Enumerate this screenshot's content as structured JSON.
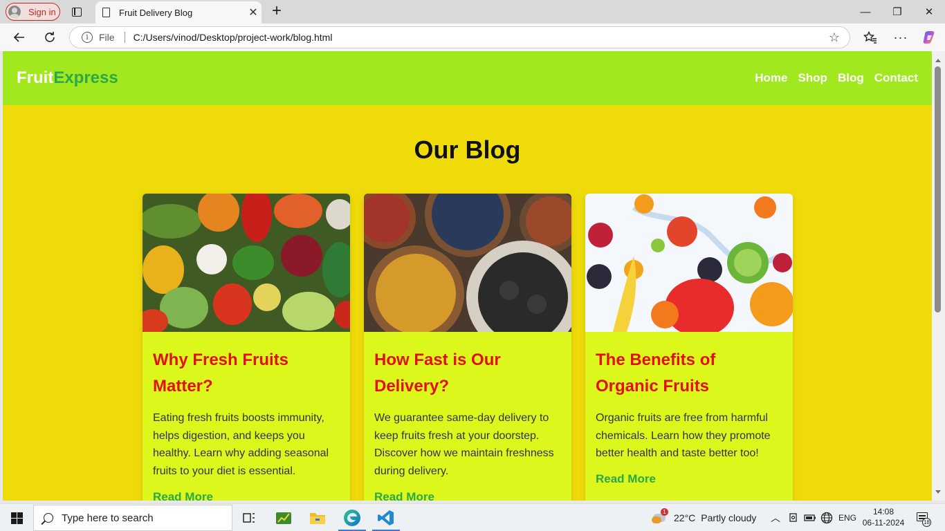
{
  "browser": {
    "signin_label": "Sign in",
    "tab_title": "Fruit Delivery Blog",
    "address_scheme": "File",
    "url": "C:/Users/vinod/Desktop/project-work/blog.html"
  },
  "site": {
    "logo_part1": "Fruit",
    "logo_part2": "Express",
    "nav": [
      "Home",
      "Shop",
      "Blog",
      "Contact"
    ],
    "page_heading": "Our Blog",
    "cards": [
      {
        "title": "Why Fresh Fruits Matter?",
        "text": "Eating fresh fruits boosts immunity, helps digestion, and keeps you healthy. Learn why adding seasonal fruits to your diet is essential.",
        "link": "Read More"
      },
      {
        "title": "How Fast is Our Delivery?",
        "text": "We guarantee same-day delivery to keep fruits fresh at your doorstep. Discover how we maintain freshness during delivery.",
        "link": "Read More"
      },
      {
        "title": "The Benefits of Organic Fruits",
        "text": "Organic fruits are free from harmful chemicals. Learn how they promote better health and taste better too!",
        "link": "Read More"
      }
    ]
  },
  "taskbar": {
    "search_placeholder": "Type here to search",
    "weather_temp": "22°C",
    "weather_desc": "Partly cloudy",
    "weather_badge": "1",
    "language": "ENG",
    "time": "14:08",
    "date": "06-11-2024",
    "notification_count": "18"
  },
  "colors": {
    "header_bg": "#a2e81e",
    "page_bg": "#f0db0a",
    "card_bg": "#dbf71c",
    "card_title": "#e31010",
    "link_green": "#2aa84a"
  }
}
